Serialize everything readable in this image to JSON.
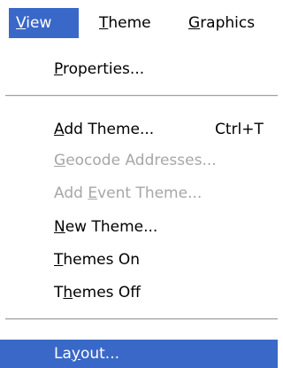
{
  "menubar": {
    "view": {
      "accel": "V",
      "rest": "iew"
    },
    "theme": {
      "accel": "T",
      "rest": "heme"
    },
    "graphics": {
      "accel": "G",
      "rest": "raphics"
    }
  },
  "menu": {
    "items": [
      {
        "pre": "",
        "accel": "P",
        "post": "roperties...",
        "shortcut": "",
        "disabled": false
      },
      {
        "pre": "",
        "accel": "A",
        "post": "dd Theme...",
        "shortcut": "Ctrl+T",
        "disabled": false
      },
      {
        "pre": "",
        "accel": "G",
        "post": "eocode Addresses...",
        "shortcut": "",
        "disabled": true
      },
      {
        "pre": "Add ",
        "accel": "E",
        "post": "vent Theme...",
        "shortcut": "",
        "disabled": true
      },
      {
        "pre": "",
        "accel": "N",
        "post": "ew Theme...",
        "shortcut": "",
        "disabled": false
      },
      {
        "pre": "",
        "accel": "T",
        "post": "hemes On",
        "shortcut": "",
        "disabled": false
      },
      {
        "pre": "T",
        "accel": "h",
        "post": "emes Off",
        "shortcut": "",
        "disabled": false
      },
      {
        "pre": "La",
        "accel": "y",
        "post": "out...",
        "shortcut": "",
        "disabled": false
      }
    ]
  },
  "colors": {
    "highlight": "#3a68c8",
    "disabled_text": "#a7a7a7"
  }
}
